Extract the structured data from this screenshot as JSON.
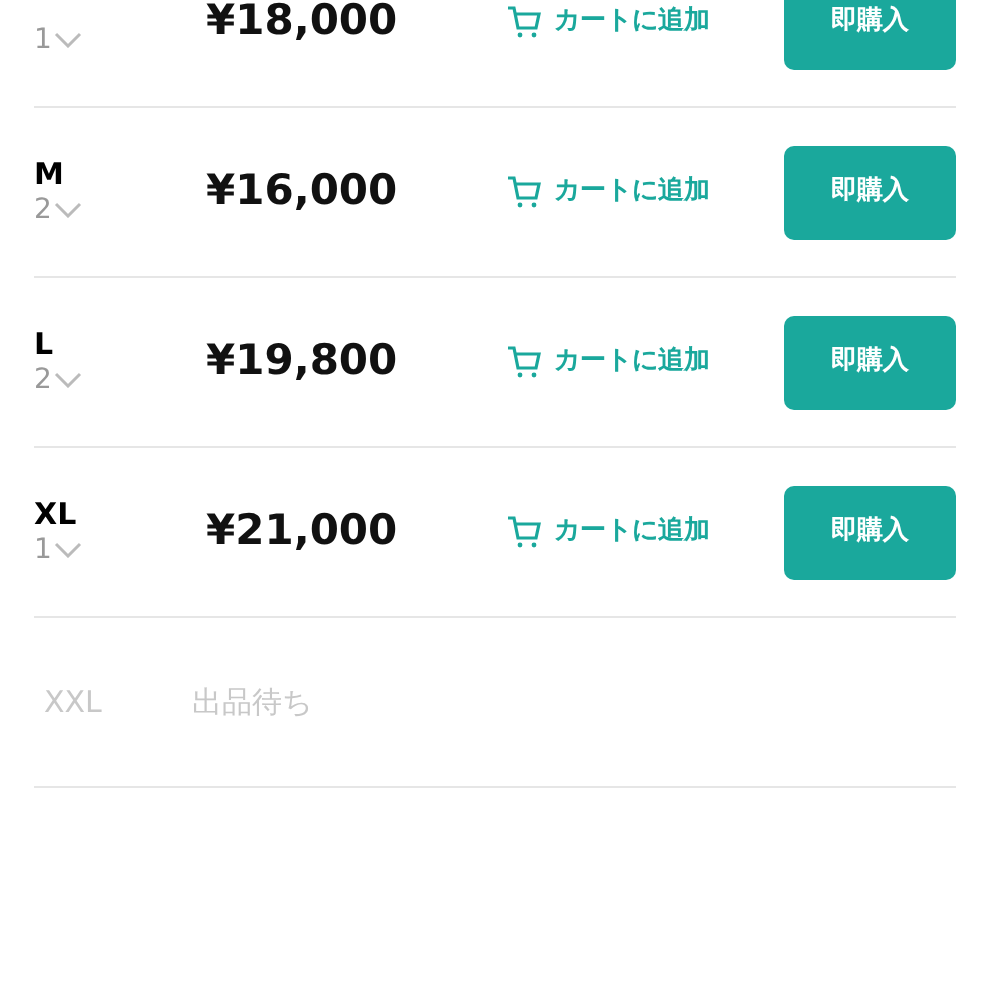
{
  "rows": [
    {
      "kind": "available",
      "quantity": "1",
      "price": "¥18,000",
      "cart_label": "カートに追加",
      "buy_label": "即購入"
    },
    {
      "kind": "available",
      "size": "M",
      "quantity": "2",
      "price": "¥16,000",
      "cart_label": "カートに追加",
      "buy_label": "即購入"
    },
    {
      "kind": "available",
      "size": "L",
      "quantity": "2",
      "price": "¥19,800",
      "cart_label": "カートに追加",
      "buy_label": "即購入"
    },
    {
      "kind": "available",
      "size": "XL",
      "quantity": "1",
      "price": "¥21,000",
      "cart_label": "カートに追加",
      "buy_label": "即購入"
    },
    {
      "kind": "waiting",
      "size": "XXL",
      "status": "出品待ち"
    }
  ]
}
